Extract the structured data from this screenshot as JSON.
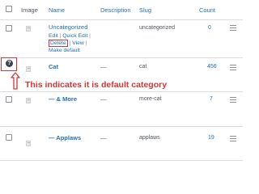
{
  "table": {
    "headers": {
      "image": "Image",
      "name": "Name",
      "description": "Description",
      "slug": "Slug",
      "count": "Count"
    },
    "rows": [
      {
        "name": "Uncategorized",
        "description": "",
        "slug": "uncategorized",
        "count": "0",
        "actions": {
          "edit": "Edit",
          "quick_edit": "Quick Edit",
          "delete": "Delete",
          "view": "View",
          "make_default": "Make default"
        }
      },
      {
        "name": "Cat",
        "description": "—",
        "slug": "cat",
        "count": "456"
      },
      {
        "name": "— & More",
        "description": "—",
        "slug": "more-cat",
        "count": "7"
      },
      {
        "name": "— Applaws",
        "description": "—",
        "slug": "applaws",
        "count": "19"
      }
    ]
  },
  "annotation": {
    "text": "This indicates it is default category",
    "help_symbol": "?",
    "color": "#d63638"
  },
  "icons": {
    "help": "question-circle-icon",
    "arrow": "arrow-up-icon",
    "drag": "drag-handle-icon",
    "thumbnail": "image-placeholder-icon"
  }
}
